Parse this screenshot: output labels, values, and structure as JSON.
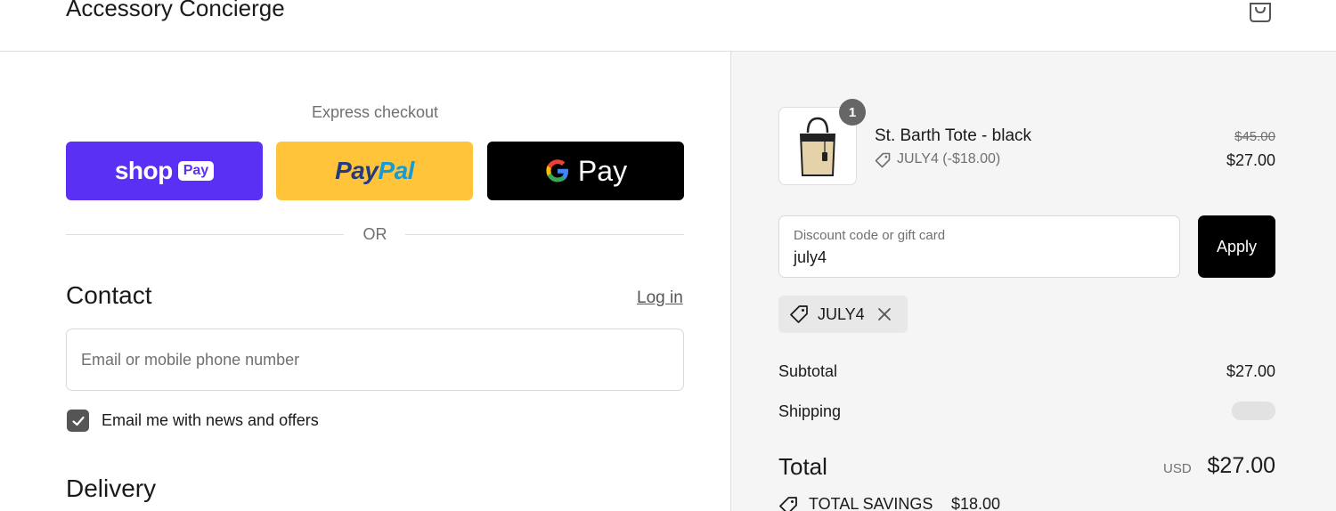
{
  "header": {
    "store_name": "Accessory Concierge",
    "cart_icon": "shopping-bag-icon"
  },
  "express": {
    "label": "Express checkout",
    "shop_pay": {
      "word": "shop",
      "tag": "Pay",
      "color": "#5a31f4"
    },
    "paypal": {
      "pay": "Pay",
      "pal": "Pal",
      "color": "#ffc439"
    },
    "gpay": {
      "g": "G",
      "word": "Pay",
      "color": "#000000"
    },
    "divider_text": "OR"
  },
  "contact": {
    "heading": "Contact",
    "login_link": "Log in",
    "email_placeholder": "Email or mobile phone number",
    "email_value": "",
    "newsletter_label": "Email me with news and offers",
    "newsletter_checked": true
  },
  "delivery": {
    "heading": "Delivery"
  },
  "summary": {
    "item": {
      "quantity": "1",
      "name": "St. Barth Tote - black",
      "discount": "JULY4 (-$18.00)",
      "original_price": "$45.00",
      "price": "$27.00"
    },
    "discount_field": {
      "label": "Discount code or gift card",
      "value": "july4"
    },
    "apply_label": "Apply",
    "applied_code": "JULY4",
    "subtotal_label": "Subtotal",
    "subtotal_value": "$27.00",
    "shipping_label": "Shipping",
    "total_label": "Total",
    "currency": "USD",
    "total_value": "$27.00",
    "savings_label": "TOTAL SAVINGS",
    "savings_value": "$18.00"
  },
  "colors": {
    "accent": "#000000",
    "summary_bg": "#f5f5f5",
    "checkbox": "#555555"
  }
}
